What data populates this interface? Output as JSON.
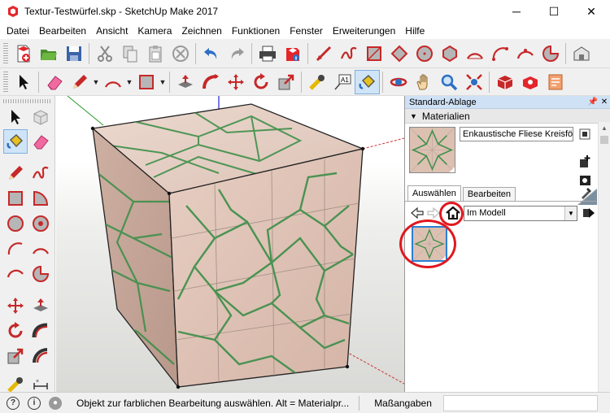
{
  "window": {
    "title": "Textur-Testwürfel.skp - SketchUp Make 2017",
    "minimize": "─",
    "maximize": "☐",
    "close": "✕"
  },
  "menu": [
    {
      "label": "Datei"
    },
    {
      "label": "Bearbeiten"
    },
    {
      "label": "Ansicht"
    },
    {
      "label": "Kamera"
    },
    {
      "label": "Zeichnen"
    },
    {
      "label": "Funktionen"
    },
    {
      "label": "Fenster"
    },
    {
      "label": "Erweiterungen"
    },
    {
      "label": "Hilfe"
    }
  ],
  "toolbar_top_icons": [
    "new-file-icon",
    "open-folder-icon",
    "save-icon",
    "cut-icon",
    "copy-icon",
    "paste-icon",
    "erase-icon",
    "undo-icon",
    "redo-icon",
    "print-icon",
    "model-info-icon",
    "line-icon",
    "freehand-icon",
    "rectangle-icon",
    "rotated-rectangle-icon",
    "circle-icon",
    "polygon-icon",
    "arc-icon",
    "two-point-arc-icon",
    "three-point-arc-icon",
    "pie-icon",
    "warehouse-icon"
  ],
  "toolbar_second_icons": [
    "select-icon",
    "eraser-icon",
    "pencil-icon",
    "arc-tool-icon",
    "shape-icon",
    "push-pull-icon",
    "follow-me-icon",
    "move-icon",
    "rotate-icon",
    "scale-icon",
    "tape-measure-icon",
    "text-icon",
    "paint-bucket-icon",
    "orbit-icon",
    "pan-icon",
    "zoom-icon",
    "zoom-extents-icon",
    "components-icon",
    "extension-warehouse-icon",
    "layout-icon"
  ],
  "tray": {
    "title": "Standard-Ablage",
    "pin": "📌",
    "close": "✕",
    "materials_heading": "Materialien",
    "material_name": "Enkaustische Fliese Kreisförmig",
    "tab_select": "Auswählen",
    "tab_edit": "Bearbeiten",
    "collection": "Im Modell"
  },
  "status": {
    "message": "Objekt zur farblichen Bearbeitung auswählen. Alt = Materialpr...",
    "measurements_label": "Maßangaben",
    "info_glyph": "i",
    "geo_glyph": "?",
    "user_glyph": "●"
  },
  "colors": {
    "tray_header": "#cfe1f5",
    "tile_base": "#e3c8bb",
    "tile_line": "#3e8f4a",
    "highlight": "#e0181f",
    "selection": "#2a7fd4"
  }
}
